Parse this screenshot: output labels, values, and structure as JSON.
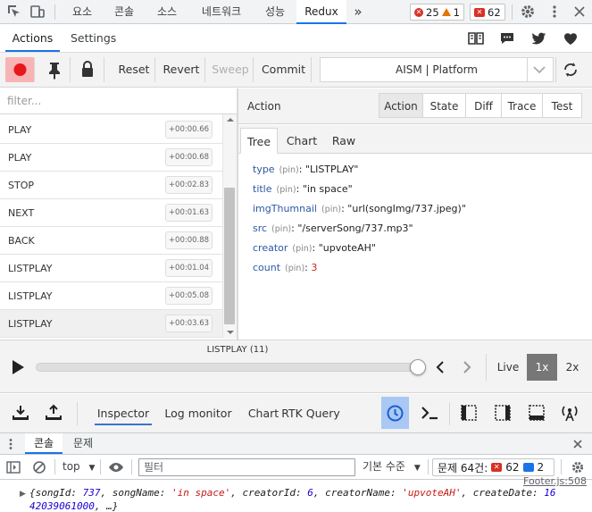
{
  "devtools": {
    "tabs": [
      {
        "label": "요소"
      },
      {
        "label": "콘솔"
      },
      {
        "label": "소스"
      },
      {
        "label": "네트워크"
      },
      {
        "label": "성능"
      },
      {
        "label": "Redux"
      }
    ],
    "more_label": "»",
    "errors_count": "25",
    "warnings_count": "1",
    "issues_count": "62"
  },
  "redux": {
    "header_tabs": [
      {
        "label": "Actions"
      },
      {
        "label": "Settings"
      }
    ],
    "toolbar": {
      "reset_label": "Reset",
      "revert_label": "Revert",
      "sweep_label": "Sweep",
      "commit_label": "Commit",
      "instance_label": "AISM | Platform"
    },
    "filter_placeholder": "filter...",
    "actions": [
      {
        "name": "PLAY",
        "time": "+00:00.66"
      },
      {
        "name": "PLAY",
        "time": "+00:00.68"
      },
      {
        "name": "STOP",
        "time": "+00:02.83"
      },
      {
        "name": "NEXT",
        "time": "+00:01.63"
      },
      {
        "name": "BACK",
        "time": "+00:00.88"
      },
      {
        "name": "LISTPLAY",
        "time": "+00:01.04"
      },
      {
        "name": "LISTPLAY",
        "time": "+00:05.08"
      },
      {
        "name": "LISTPLAY",
        "time": "+00:03.63"
      }
    ],
    "inspector": {
      "title": "Action",
      "views": [
        {
          "label": "Action"
        },
        {
          "label": "State"
        },
        {
          "label": "Diff"
        },
        {
          "label": "Trace"
        },
        {
          "label": "Test"
        }
      ],
      "sub_tabs": [
        {
          "label": "Tree"
        },
        {
          "label": "Chart"
        },
        {
          "label": "Raw"
        }
      ],
      "pin_label": "(pin)",
      "tree": [
        {
          "key": "type",
          "value": "\"LISTPLAY\""
        },
        {
          "key": "title",
          "value": "\"in space\""
        },
        {
          "key": "imgThumnail",
          "value": "\"url(songImg/737.jpeg)\""
        },
        {
          "key": "src",
          "value": "\"/serverSong/737.mp3\""
        },
        {
          "key": "creator",
          "value": "\"upvoteAH\""
        },
        {
          "key": "count",
          "value": "3"
        }
      ]
    },
    "slider": {
      "label": "LISTPLAY (11)",
      "position": 0.99,
      "live_label": "Live",
      "speeds": [
        {
          "label": "1x"
        },
        {
          "label": "2x"
        }
      ]
    },
    "bottom_tabs": [
      {
        "label": "Inspector"
      },
      {
        "label": "Log monitor"
      },
      {
        "label": "Chart"
      },
      {
        "label": "RTK Query"
      }
    ]
  },
  "drawer": {
    "tabs": [
      {
        "label": "콘솔"
      },
      {
        "label": "문제"
      }
    ],
    "context_label": "top",
    "filter_placeholder": "필터",
    "levels_label": "기본 수준",
    "issues_label": "문제 64건:",
    "issues_errors": "62",
    "issues_info": "2",
    "log_source": "Footer.js:508",
    "log_line1": [
      {
        "t": "{",
        "c": "k"
      },
      {
        "t": "songId: ",
        "c": "k"
      },
      {
        "t": "737",
        "c": "n"
      },
      {
        "t": ", songName: ",
        "c": "k"
      },
      {
        "t": "'in space'",
        "c": "s"
      },
      {
        "t": ", creatorId: ",
        "c": "k"
      },
      {
        "t": "6",
        "c": "n"
      },
      {
        "t": ", creatorName: ",
        "c": "k"
      },
      {
        "t": "'upvoteAH'",
        "c": "s"
      },
      {
        "t": ", createDate: ",
        "c": "k"
      },
      {
        "t": "16",
        "c": "n"
      }
    ],
    "log_line2": [
      {
        "t": "42039061000",
        "c": "n"
      },
      {
        "t": ", …}",
        "c": "k"
      }
    ]
  },
  "colors": {
    "accent": "#1a73e8",
    "record_bg": "#f8b4b4",
    "record_dot": "#e8171b",
    "persist_bg": "#a9c8f4"
  }
}
